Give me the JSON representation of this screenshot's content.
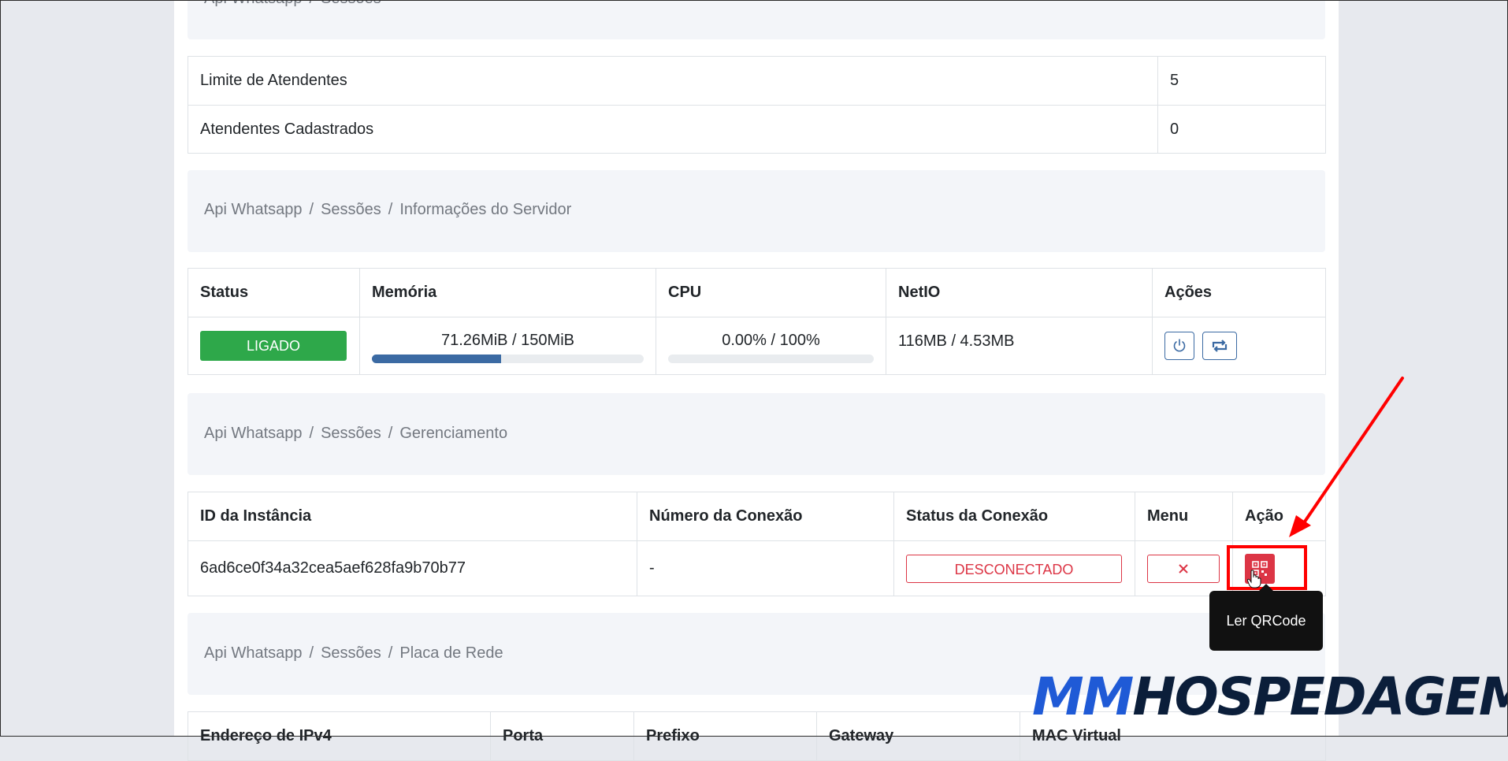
{
  "top_breadcrumb": [
    "Api Whatsapp",
    "Sessões"
  ],
  "limits_table": {
    "rows": [
      {
        "label": "Limite de Atendentes",
        "value": "5"
      },
      {
        "label": "Atendentes Cadastrados",
        "value": "0"
      }
    ]
  },
  "server_breadcrumb": [
    "Api Whatsapp",
    "Sessões",
    "Informações do Servidor"
  ],
  "server_table": {
    "headers": [
      "Status",
      "Memória",
      "CPU",
      "NetIO",
      "Ações"
    ],
    "status": "LIGADO",
    "memory": {
      "label": "71.26MiB / 150MiB",
      "fraction": 0.475
    },
    "cpu": {
      "label": "0.00% / 100%",
      "fraction": 0.0
    },
    "netio": "116MB / 4.53MB",
    "actions": [
      "power-icon",
      "refresh-icon"
    ]
  },
  "management_breadcrumb": [
    "Api Whatsapp",
    "Sessões",
    "Gerenciamento"
  ],
  "management_table": {
    "headers": [
      "ID da Instância",
      "Número da Conexão",
      "Status da Conexão",
      "Menu",
      "Ação"
    ],
    "row": {
      "id": "6ad6ce0f34a32cea5aef628fa9b70b77",
      "number": "-",
      "status": "DESCONECTADO",
      "menu_icon": "close-icon",
      "action_icon": "qrcode-icon"
    }
  },
  "tooltip": "Ler QRCode",
  "network_breadcrumb": [
    "Api Whatsapp",
    "Sessões",
    "Placa de Rede"
  ],
  "network_table": {
    "headers": [
      "Endereço de IPv4",
      "Porta",
      "Prefixo",
      "Gateway",
      "MAC Virtual"
    ]
  },
  "watermark": {
    "part1": "MM",
    "part2": "HOSPEDAGEM"
  },
  "colors": {
    "success": "#2ea84a",
    "danger": "#dc3545",
    "primary": "#3b6aa3",
    "annotation": "#ff0000"
  }
}
